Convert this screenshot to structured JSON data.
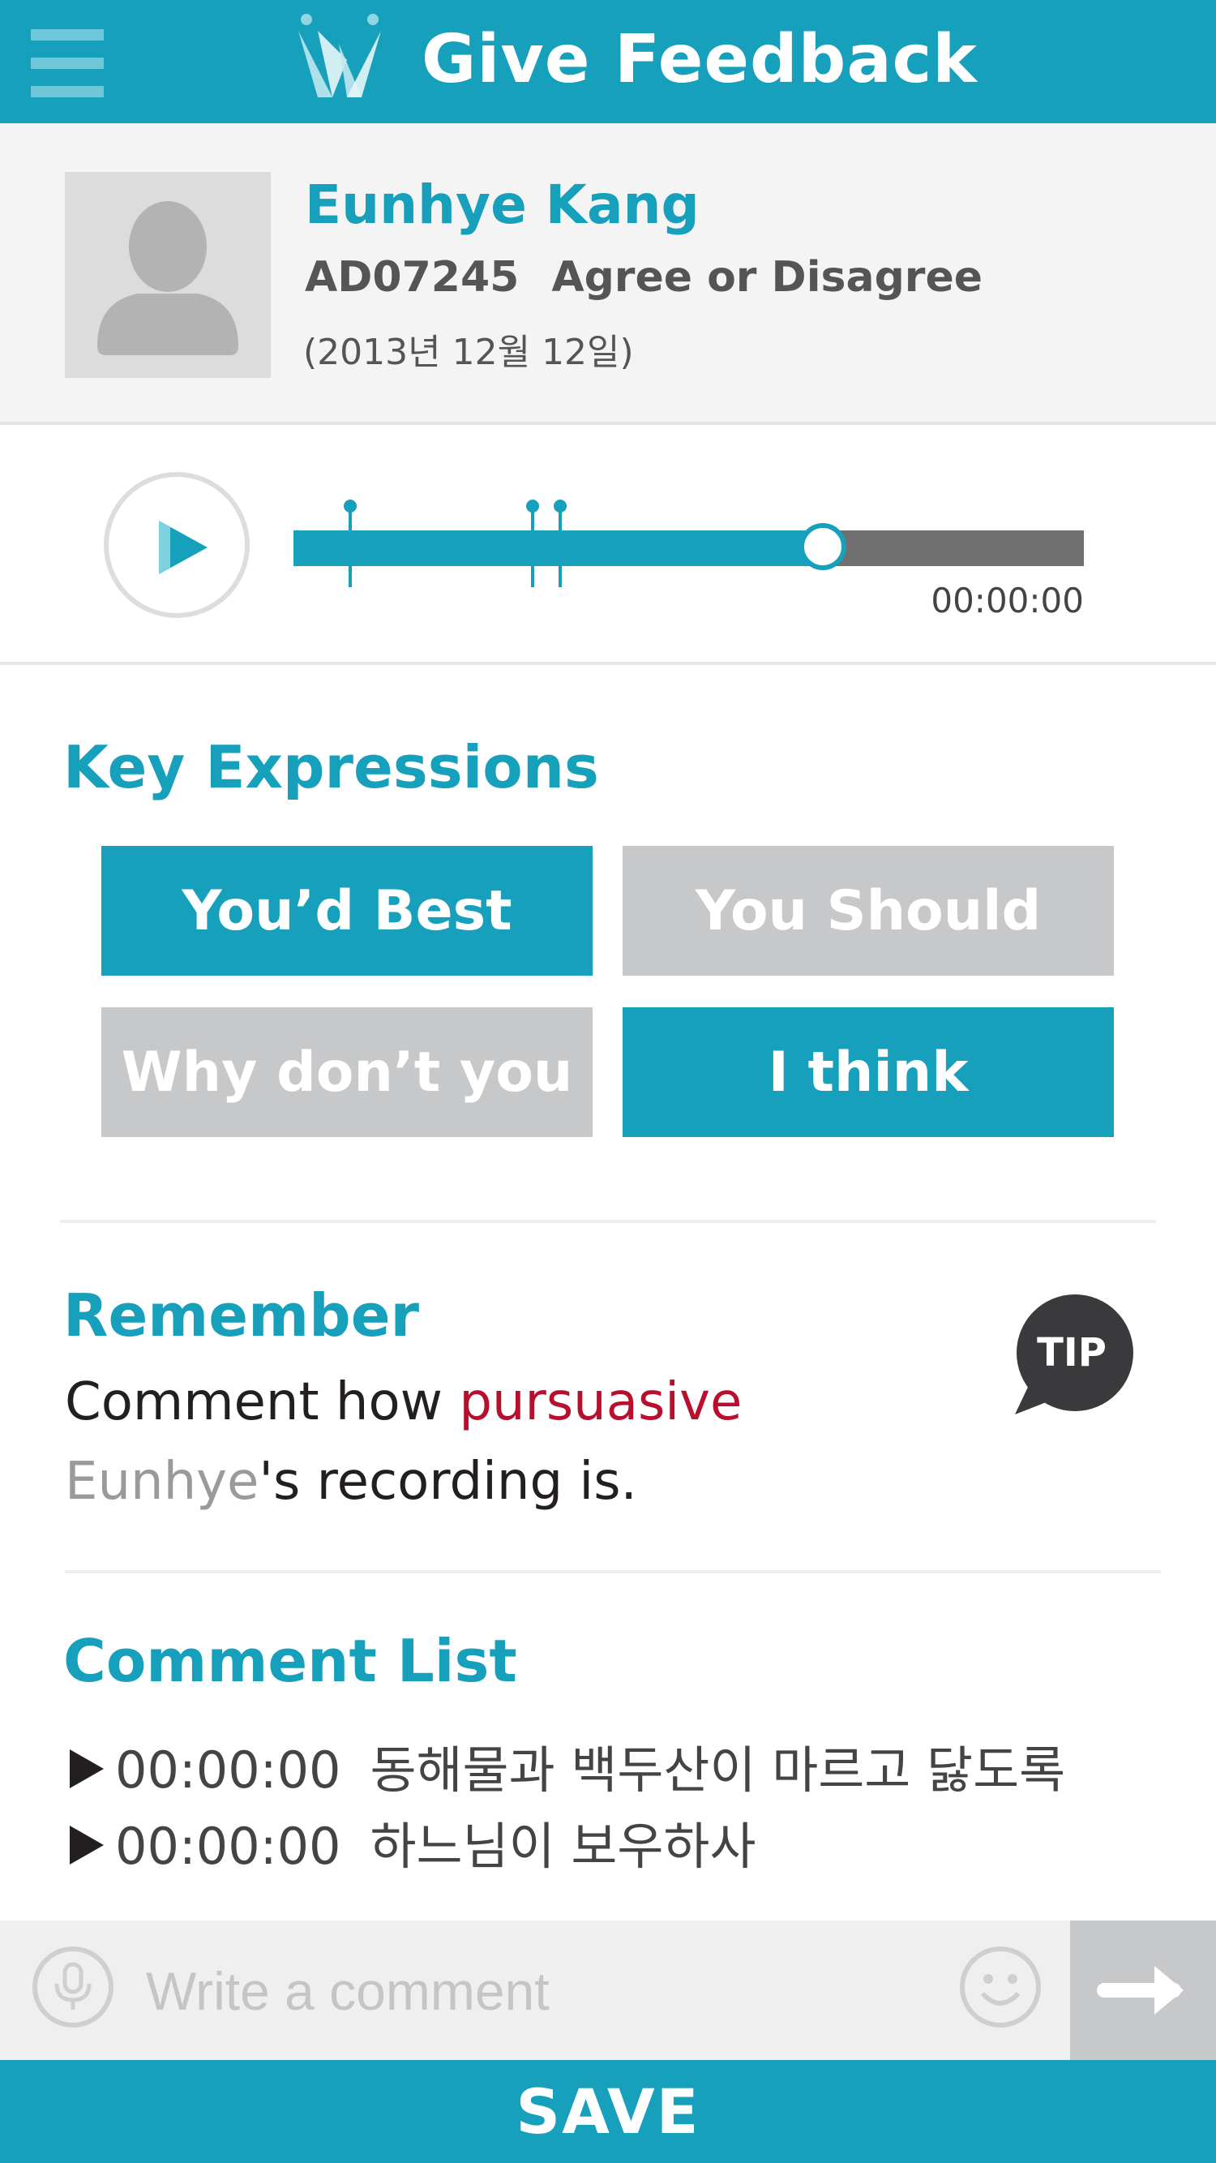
{
  "header": {
    "title": "Give Feedback"
  },
  "profile": {
    "name": "Eunhye Kang",
    "code": "AD07245",
    "topic": "Agree or Disagree",
    "date": "(2013년 12월 12일)"
  },
  "player": {
    "time": "00:00:00",
    "progress": 0.67,
    "markers": [
      0.07,
      0.3,
      0.335
    ]
  },
  "key_expressions": {
    "title": "Key Expressions",
    "buttons": [
      {
        "label": "You’d Best",
        "active": true
      },
      {
        "label": "You Should",
        "active": false
      },
      {
        "label": "Why don’t you",
        "active": false
      },
      {
        "label": "I think",
        "active": true
      }
    ]
  },
  "remember": {
    "title": "Remember",
    "text_before": "Comment how ",
    "highlight": "pursuasive",
    "text_mid": " ",
    "name": "Eunhye",
    "text_after": "'s recording is.",
    "tip_label": "TIP"
  },
  "comments": {
    "title": "Comment List",
    "items": [
      {
        "time": "00:00:00",
        "text": "동해물과 백두산이 마르고 닳도록"
      },
      {
        "time": "00:00:00",
        "text": "하느님이 보우하사"
      }
    ]
  },
  "input": {
    "placeholder": "Write a comment"
  },
  "save": {
    "label": "SAVE"
  },
  "colors": {
    "accent": "#17a0bb",
    "inactive": "#c7c8ca",
    "highlight": "#b8102c"
  }
}
